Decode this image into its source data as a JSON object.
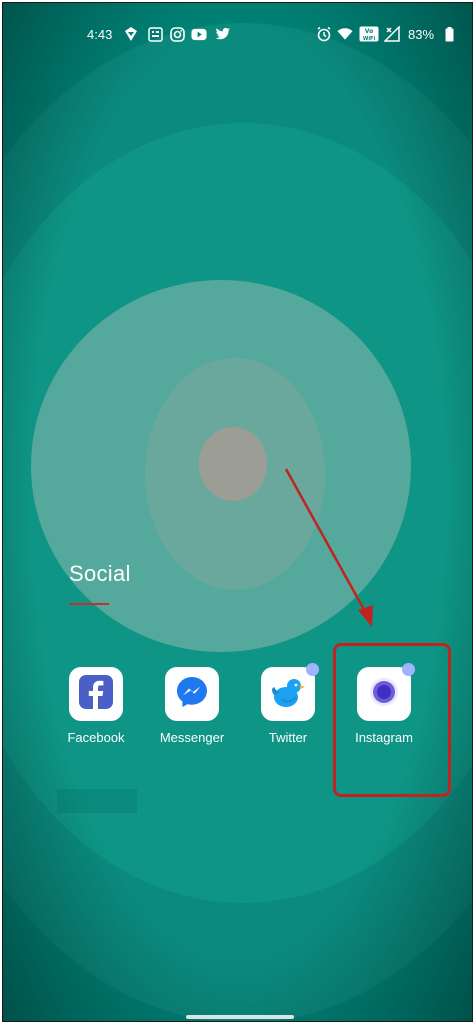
{
  "status_bar": {
    "time": "4:43",
    "battery_percent": "83%",
    "left_icons": [
      "signal-notification-icon",
      "grid-app-icon",
      "instagram-icon",
      "youtube-icon",
      "twitter-icon"
    ],
    "right_icons": [
      "alarm-icon",
      "wifi-icon",
      "vowifi-icon",
      "no-signal-icon",
      "battery-icon"
    ]
  },
  "folder": {
    "title": "Social",
    "apps": [
      {
        "label": "Facebook",
        "icon": "facebook-icon",
        "accent": "#3b5bdb"
      },
      {
        "label": "Messenger",
        "icon": "messenger-icon",
        "accent": "#1877f2"
      },
      {
        "label": "Twitter",
        "icon": "twitter-icon",
        "accent": "#1da1f2",
        "badge": true
      },
      {
        "label": "Instagram",
        "icon": "instagram-icon",
        "accent": "#5b4fcf",
        "badge": true
      }
    ]
  },
  "annotation": {
    "color": "#c0241f",
    "target": "Instagram"
  },
  "colors": {
    "wallpaper": "#008276",
    "accent_underline": "#c03030"
  }
}
